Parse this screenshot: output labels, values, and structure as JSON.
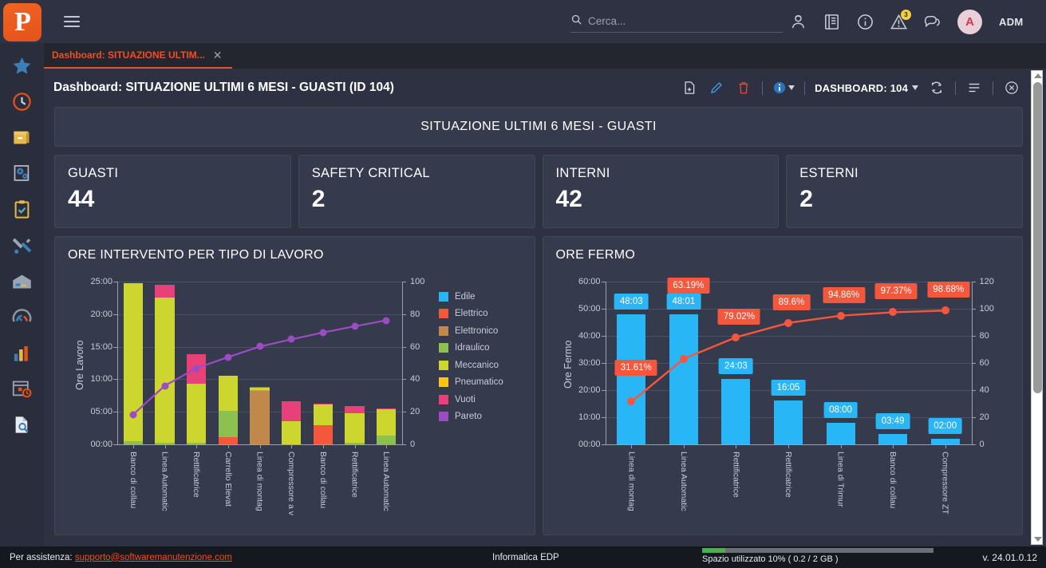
{
  "topbar": {
    "logo_letter": "P",
    "menu_icon": "hamburger-icon",
    "search": {
      "placeholder": "Cerca...",
      "value": ""
    },
    "icons": [
      {
        "name": "user-profile-icon"
      },
      {
        "name": "book-icon"
      },
      {
        "name": "info-icon"
      },
      {
        "name": "alert-warning-icon",
        "badge": "3"
      },
      {
        "name": "chat-icon"
      }
    ],
    "avatar_initial": "A",
    "username": "ADM"
  },
  "sidebar": {
    "items": [
      {
        "name": "favorites-star-icon",
        "label": "Preferiti"
      },
      {
        "name": "clock-history-icon",
        "label": "Recenti"
      },
      {
        "name": "archive-box-icon",
        "label": "Anagrafiche"
      },
      {
        "name": "gears-document-icon",
        "label": "Impianti"
      },
      {
        "name": "clipboard-check-icon",
        "label": "Attivita"
      },
      {
        "name": "tools-icon",
        "label": "Manutenzione"
      },
      {
        "name": "warehouse-icon",
        "label": "Magazzino"
      },
      {
        "name": "gauge-icon",
        "label": "Monitoraggio"
      },
      {
        "name": "bar-chart-icon",
        "label": "Statistiche"
      },
      {
        "name": "calendar-clock-icon",
        "label": "Pianificazione"
      },
      {
        "name": "document-search-icon",
        "label": "Ricerca"
      }
    ]
  },
  "tabs": [
    {
      "label": "Dashboard: SITUAZIONE ULTIM...",
      "close": "✕",
      "active": true
    }
  ],
  "dashboard": {
    "title": "Dashboard: SITUAZIONE ULTIMI 6 MESI - GUASTI (ID 104)",
    "actions": [
      {
        "name": "new-document-icon"
      },
      {
        "name": "edit-pencil-icon"
      },
      {
        "name": "delete-trash-icon"
      },
      {
        "name": "info-circle-icon"
      }
    ],
    "selector_label": "DASHBOARD: 104",
    "refresh_icon": "refresh-icon",
    "list-view_icon": "list-lines-icon",
    "close_icon": "close-circle-icon",
    "banner_title": "SITUAZIONE ULTIMI 6 MESI - GUASTI"
  },
  "kpis": [
    {
      "label": "GUASTI",
      "value": "44"
    },
    {
      "label": "SAFETY CRITICAL",
      "value": "2"
    },
    {
      "label": "INTERNI",
      "value": "42"
    },
    {
      "label": "ESTERNI",
      "value": "2"
    }
  ],
  "chart_data": [
    {
      "type": "bar",
      "title": "ORE INTERVENTO PER TIPO DI LAVORO",
      "xlabel": "",
      "ylabel": "Ore Lavoro",
      "ylim": [
        0,
        25
      ],
      "yticks": [
        "00:00",
        "05:00",
        "10:00",
        "15:00",
        "20:00",
        "25:00"
      ],
      "y2label": "",
      "y2lim": [
        0,
        100
      ],
      "y2ticks": [
        "0",
        "20",
        "40",
        "60",
        "80",
        "100"
      ],
      "grid": true,
      "legend_position": "right",
      "stacked": true,
      "categories": [
        "Banco di collau",
        "Linea Automatic",
        "Rettificatrice",
        "Carrello Elevat",
        "Linea di montag",
        "Compressore a v",
        "Banco di collau",
        "Rettificatrice",
        "Linea Automatic"
      ],
      "series": [
        {
          "name": "Edile",
          "color": "#29b6f6",
          "values": [
            0,
            0,
            0,
            0,
            0,
            0,
            0,
            0,
            0
          ]
        },
        {
          "name": "Elettrico",
          "color": "#f4573c",
          "values": [
            0,
            0,
            0,
            1.15,
            0,
            0,
            2.9,
            0,
            0
          ]
        },
        {
          "name": "Elettronico",
          "color": "#c0884a",
          "values": [
            0,
            0,
            0,
            0,
            8.2,
            0,
            0,
            0,
            0
          ]
        },
        {
          "name": "Idraulico",
          "color": "#8cc152",
          "values": [
            0.45,
            0.2,
            0.2,
            4.0,
            0.15,
            0,
            0,
            0.2,
            1.35
          ]
        },
        {
          "name": "Meccanico",
          "color": "#cdd62e",
          "values": [
            24.25,
            22.3,
            9.1,
            5.4,
            0.3,
            3.5,
            3.3,
            4.6,
            4.1
          ]
        },
        {
          "name": "Pneumatico",
          "color": "#fcc419",
          "values": [
            0,
            0,
            0,
            0,
            0,
            0,
            0,
            0,
            0
          ]
        },
        {
          "name": "Vuoti",
          "color": "#e8417a",
          "values": [
            0,
            2.05,
            4.5,
            0,
            0.2,
            3.15,
            0.1,
            1.05,
            0.05
          ]
        }
      ],
      "pareto": {
        "name": "Pareto",
        "color": "#9c4bc4",
        "values": [
          18.3,
          36.0,
          46.8,
          53.6,
          60.1,
          64.5,
          68.7,
          72.5,
          76.2
        ]
      }
    },
    {
      "type": "bar",
      "title": "ORE FERMO",
      "xlabel": "",
      "ylabel": "Ore Fermo",
      "ylim": [
        0,
        60
      ],
      "yticks": [
        "00:00",
        "10:00",
        "20:00",
        "30:00",
        "40:00",
        "50:00",
        "60:00"
      ],
      "y2lim": [
        0,
        120
      ],
      "y2ticks": [
        "0",
        "20",
        "40",
        "60",
        "80",
        "100",
        "120"
      ],
      "grid": true,
      "legend_position": "none",
      "bar_color": "#29b6f6",
      "pareto_color": "#f4573c",
      "categories": [
        "Linea di montag",
        "Linea Automatic",
        "Rettificatrice",
        "Rettificatrice",
        "Linea di Trimur",
        "Banco di collau",
        "Compressore ZT"
      ],
      "values": [
        48.05,
        48.02,
        24.05,
        16.08,
        8.0,
        3.82,
        2.0
      ],
      "value_labels": [
        "48:03",
        "48:01",
        "24:03",
        "16:05",
        "08:00",
        "03:49",
        "02:00"
      ],
      "pareto_values": [
        31.61,
        63.19,
        79.02,
        89.6,
        94.86,
        97.37,
        98.68
      ],
      "pareto_labels": [
        "31.61%",
        "63.19%",
        "79.02%",
        "89.6%",
        "94.86%",
        "97.37%",
        "98.68%"
      ]
    }
  ],
  "footer": {
    "assist_prefix": "Per assistenza:",
    "assist_email": "supporto@softwaremanutenzione.com",
    "center_text": "Informatica EDP",
    "storage_text": "Spazio utilizzato 10% ( 0.2 / 2 GB )",
    "storage_percent": 10,
    "version": "v. 24.01.0.12"
  },
  "colors": {
    "accent": "#f04e23",
    "panel": "#353a4d",
    "background": "#2d3142"
  }
}
